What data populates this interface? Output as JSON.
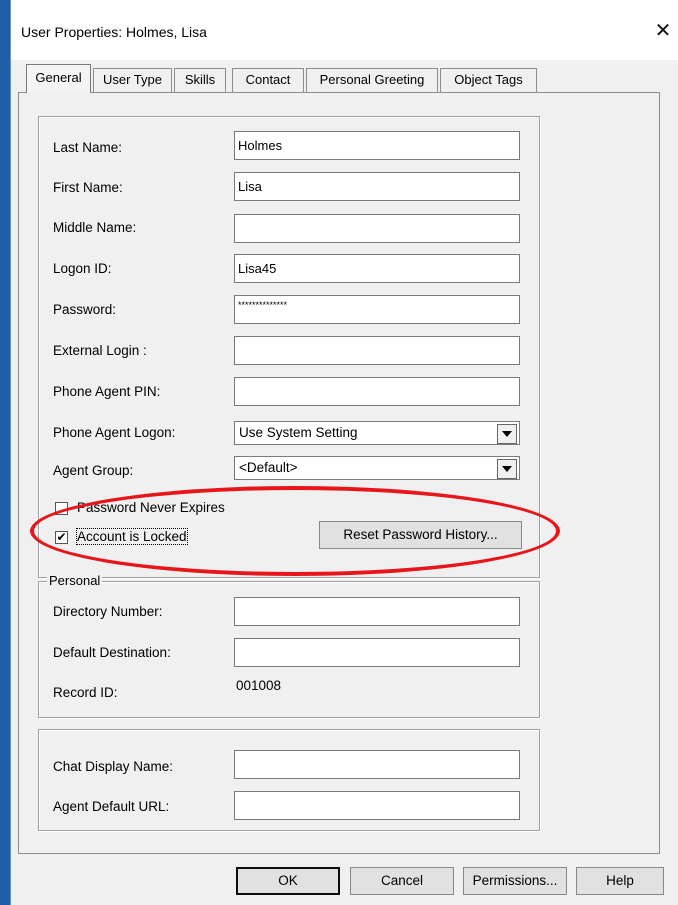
{
  "window": {
    "title": "User Properties: Holmes, Lisa",
    "close_glyph": "✕"
  },
  "tabs": [
    {
      "label": "General",
      "active": true
    },
    {
      "label": "User Type",
      "active": false
    },
    {
      "label": "Skills",
      "active": false
    },
    {
      "label": "Contact",
      "active": false
    },
    {
      "label": "Personal Greeting",
      "active": false
    },
    {
      "label": "Object Tags",
      "active": false
    }
  ],
  "general": {
    "last_name": {
      "label": "Last Name:",
      "value": "Holmes"
    },
    "first_name": {
      "label": "First Name:",
      "value": "Lisa"
    },
    "middle_name": {
      "label": "Middle Name:",
      "value": ""
    },
    "logon_id": {
      "label": "Logon ID:",
      "value": "Lisa45"
    },
    "password": {
      "label": "Password:",
      "value": "**************"
    },
    "external_login": {
      "label": "External Login :",
      "value": ""
    },
    "phone_agent_pin": {
      "label": "Phone Agent PIN:",
      "value": ""
    },
    "phone_agent_logon": {
      "label": "Phone Agent Logon:",
      "value": "Use System Setting"
    },
    "agent_group": {
      "label": "Agent Group:",
      "value": "<Default>"
    },
    "password_never_expires": {
      "label": "Password Never Expires",
      "checked": false
    },
    "account_is_locked": {
      "label": "Account is Locked",
      "checked": true
    },
    "reset_password_history": "Reset Password History..."
  },
  "personal": {
    "legend": "Personal",
    "directory_number": {
      "label": "Directory Number:",
      "value": ""
    },
    "default_destination": {
      "label": "Default Destination:",
      "value": ""
    },
    "record_id": {
      "label": "Record ID:",
      "value": "001008"
    }
  },
  "chat": {
    "chat_display_name": {
      "label": "Chat Display Name:",
      "value": ""
    },
    "agent_default_url": {
      "label": "Agent Default URL:",
      "value": ""
    }
  },
  "buttons": {
    "ok": "OK",
    "cancel": "Cancel",
    "permissions": "Permissions...",
    "help": "Help"
  },
  "colors": {
    "annotation_oval": "#e8151b",
    "window_frame": "#1f5fa8"
  },
  "checkmark_glyph": "✔"
}
